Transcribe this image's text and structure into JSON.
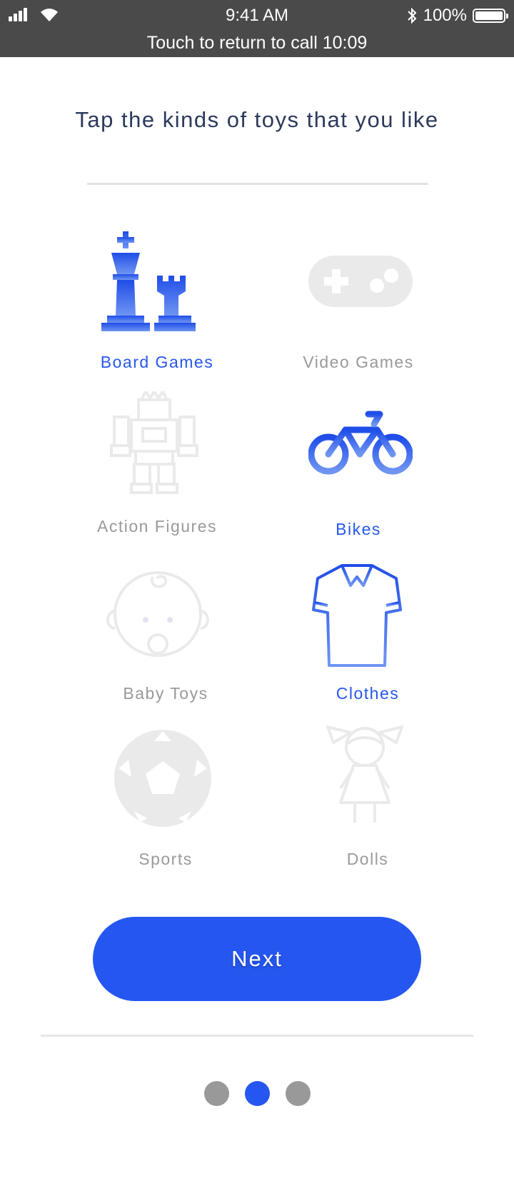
{
  "status_bar": {
    "time": "9:41 AM",
    "call_banner": "Touch to return to call 10:09",
    "battery": "100%"
  },
  "title": "Tap the kinds of toys that you like",
  "categories": [
    {
      "label": "Board Games",
      "icon": "chess-icon",
      "selected": true
    },
    {
      "label": "Video Games",
      "icon": "gamepad-icon",
      "selected": false
    },
    {
      "label": "Action Figures",
      "icon": "robot-icon",
      "selected": false
    },
    {
      "label": "Bikes",
      "icon": "bike-icon",
      "selected": true
    },
    {
      "label": "Baby Toys",
      "icon": "baby-icon",
      "selected": false
    },
    {
      "label": "Clothes",
      "icon": "shirt-icon",
      "selected": true
    },
    {
      "label": "Sports",
      "icon": "soccer-ball-icon",
      "selected": false
    },
    {
      "label": "Dolls",
      "icon": "doll-icon",
      "selected": false
    }
  ],
  "next_button": "Next",
  "pager": {
    "current": 2,
    "total": 3
  },
  "colors": {
    "accent": "#2557f0",
    "inactive": "#e9e9e9",
    "label_inactive": "#9a9a9a",
    "status_bar": "#4a4a4a"
  }
}
